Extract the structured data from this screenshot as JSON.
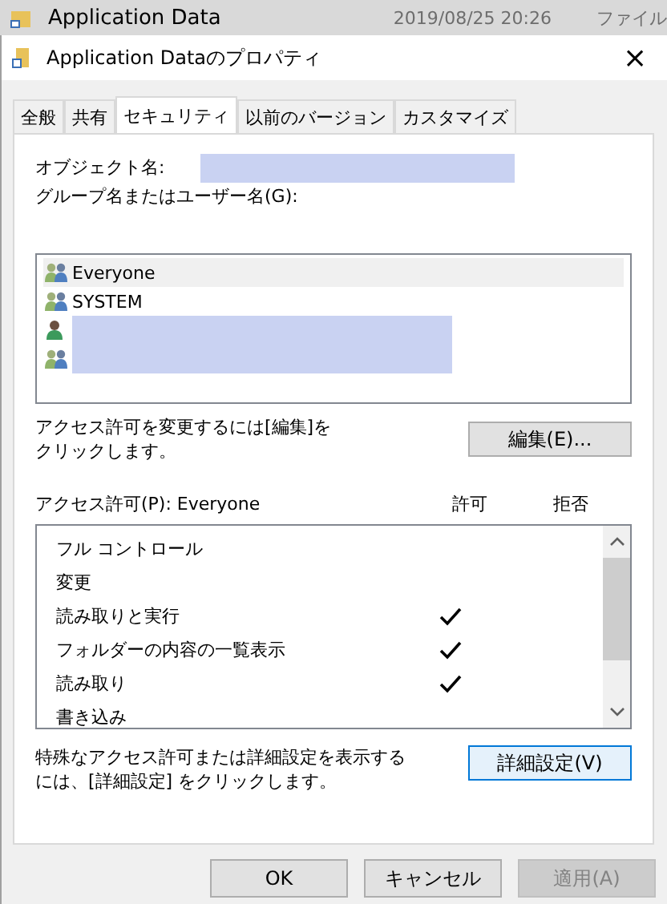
{
  "explorer_row": {
    "name": "Application Data",
    "date": "2019/08/25 20:26",
    "type": "ファイル"
  },
  "window": {
    "title": "Application Dataのプロパティ",
    "close": "×"
  },
  "tabs": [
    {
      "label": "全般",
      "selected": false
    },
    {
      "label": "共有",
      "selected": false
    },
    {
      "label": "セキュリティ",
      "selected": true
    },
    {
      "label": "以前のバージョン",
      "selected": false
    },
    {
      "label": "カスタマイズ",
      "selected": false
    }
  ],
  "object_name": {
    "label": "オブジェクト名:",
    "redacted": true
  },
  "users_label": "グループ名またはユーザー名(G):",
  "users": [
    {
      "kind": "group",
      "name": "Everyone",
      "selected": true,
      "redacted": false
    },
    {
      "kind": "group",
      "name": "SYSTEM",
      "selected": false,
      "redacted": false
    },
    {
      "kind": "user",
      "selected": false,
      "redacted": true
    },
    {
      "kind": "group",
      "selected": false,
      "redacted": true
    }
  ],
  "edit_hint": [
    "アクセス許可を変更するには[編集]を",
    "クリックします。"
  ],
  "edit_button": "編集(E)...",
  "permissions": {
    "label": "アクセス許可(P): Everyone",
    "allow_header": "許可",
    "deny_header": "拒否",
    "rows": [
      {
        "name": "フル コントロール",
        "allow": false,
        "deny": false
      },
      {
        "name": "変更",
        "allow": false,
        "deny": false
      },
      {
        "name": "読み取りと実行",
        "allow": true,
        "deny": false
      },
      {
        "name": "フォルダーの内容の一覧表示",
        "allow": true,
        "deny": false
      },
      {
        "name": "読み取り",
        "allow": true,
        "deny": false
      },
      {
        "name": "書き込み",
        "allow": false,
        "deny": false
      }
    ]
  },
  "advanced_hint": [
    "特殊なアクセス許可または詳細設定を表示する",
    "には、[詳細設定] をクリックします。"
  ],
  "advanced_button": "詳細設定(V)",
  "buttons": [
    {
      "label": "OK",
      "disabled": false
    },
    {
      "label": "キャンセル",
      "disabled": false
    },
    {
      "label": "適用(A)",
      "disabled": true
    }
  ]
}
